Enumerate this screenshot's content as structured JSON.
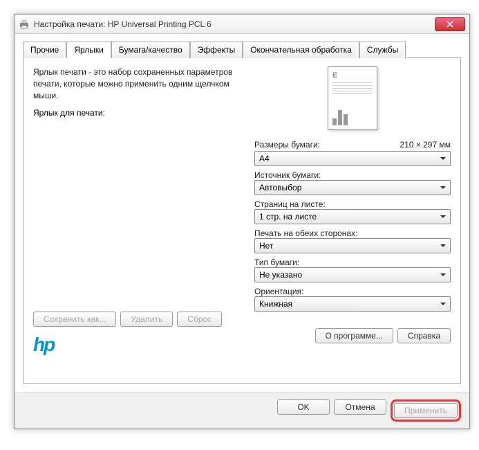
{
  "window": {
    "title": "Настройка печати: HP Universal Printing PCL 6"
  },
  "tabs": [
    "Прочие",
    "Ярлыки",
    "Бумага/качество",
    "Эффекты",
    "Окончательная обработка",
    "Службы"
  ],
  "panel": {
    "description": "Ярлык печати - это набор сохраненных параметров печати, которые можно применить одним щелчком мыши.",
    "shortcutLabel": "Ярлык для печати:",
    "fields": {
      "paperSize": {
        "label": "Размеры бумаги:",
        "value": "A4",
        "extra": "210 × 297 мм"
      },
      "paperSource": {
        "label": "Источник бумаги:",
        "value": "Автовыбор"
      },
      "pagesPerSheet": {
        "label": "Страниц на листе:",
        "value": "1 стр. на листе"
      },
      "duplex": {
        "label": "Печать на обеих сторонах:",
        "value": "Нет"
      },
      "paperType": {
        "label": "Тип бумаги:",
        "value": "Не указано"
      },
      "orientation": {
        "label": "Ориентация:",
        "value": "Книжная"
      }
    },
    "actions": {
      "saveAs": "Сохранить как...",
      "delete": "Удалить",
      "reset": "Сброс"
    },
    "info": {
      "about": "О программе...",
      "help": "Справка"
    }
  },
  "dialog": {
    "ok": "OK",
    "cancel": "Отмена",
    "apply": "Применить"
  },
  "logo": "hp"
}
